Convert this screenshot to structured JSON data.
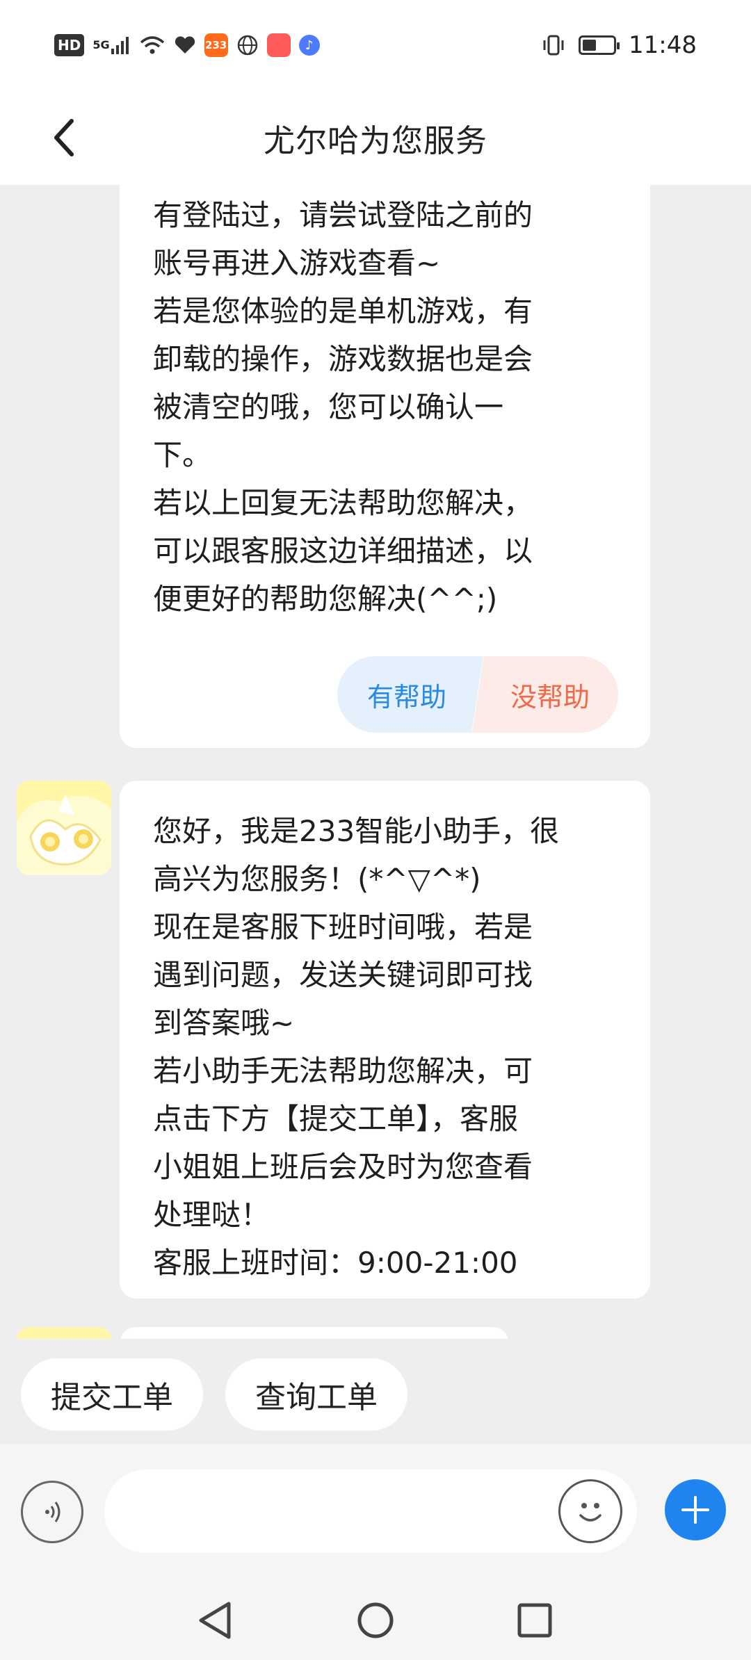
{
  "status_bar": {
    "hd": "HD",
    "network": "5G",
    "app_badge": "233",
    "time": "11:48"
  },
  "header": {
    "title": "尤尔哈为您服务"
  },
  "messages": [
    {
      "text": "是否是游客账号状态，若之前\n有登陆过，请尝试登陆之前的\n账号再进入游戏查看~\n若是您体验的是单机游戏，有\n卸载的操作，游戏数据也是会\n被清空的哦，您可以确认一\n下。\n若以上回复无法帮助您解决，\n可以跟客服这边详细描述，以\n便更好的帮助您解决(^^;)",
      "helpful_label": "有帮助",
      "not_helpful_label": "没帮助"
    },
    {
      "text": "您好，我是233智能小助手，很\n高兴为您服务！(*^▽^*)\n现在是客服下班时间哦，若是\n遇到问题，发送关键词即可找\n到答案哦~\n若小助手无法帮助您解决，可\n点击下方【提交工单】，客服\n小姐姐上班后会及时为您查看\n处理哒！\n客服上班时间：9:00-21:00"
    }
  ],
  "quick_replies": [
    "提交工单",
    "查询工单"
  ],
  "input": {
    "value": "",
    "placeholder": ""
  },
  "colors": {
    "accent": "#1f84f0",
    "helpful": "#2a8ae0",
    "not_helpful": "#ef6a4b",
    "background": "#eeeeee"
  },
  "icons": [
    "back-icon",
    "voice-icon",
    "emoji-icon",
    "plus-icon",
    "nav-back-icon",
    "nav-home-icon",
    "nav-recent-icon"
  ]
}
